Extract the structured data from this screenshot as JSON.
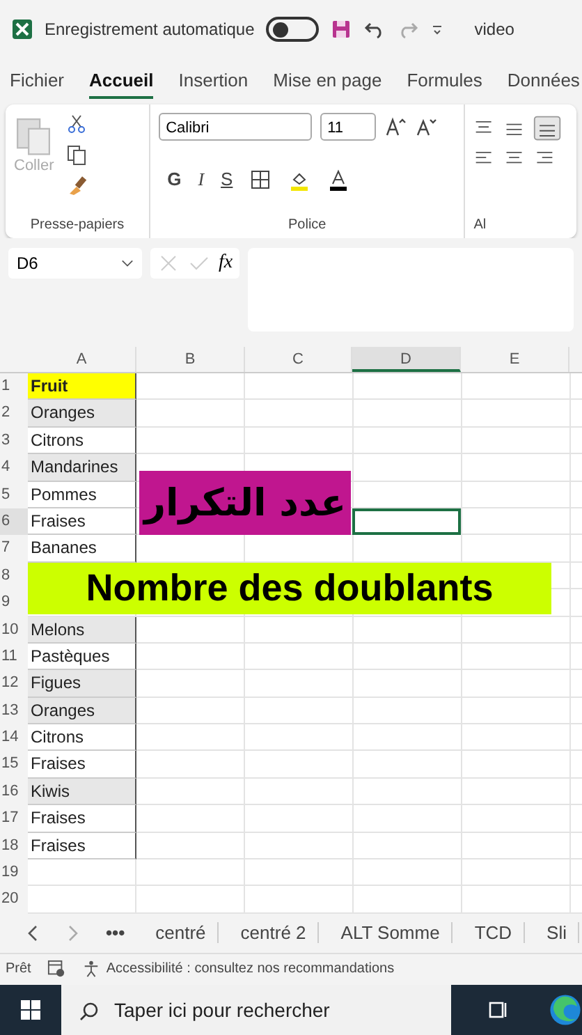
{
  "title_bar": {
    "autosave_label": "Enregistrement automatique",
    "autosave_on": false,
    "file_name": "video"
  },
  "tabs": [
    {
      "label": "Fichier",
      "selected": false
    },
    {
      "label": "Accueil",
      "selected": true
    },
    {
      "label": "Insertion",
      "selected": false
    },
    {
      "label": "Mise en page",
      "selected": false
    },
    {
      "label": "Formules",
      "selected": false
    },
    {
      "label": "Données",
      "selected": false
    }
  ],
  "ribbon": {
    "paste_label": "Coller",
    "clipboard_group": "Presse-papiers",
    "font_name": "Calibri",
    "font_size": "11",
    "bold": "G",
    "italic": "I",
    "underline": "S",
    "font_group": "Police",
    "align_group": "Al"
  },
  "formula_bar": {
    "cell_ref": "D6",
    "fx": "fx"
  },
  "columns": [
    {
      "label": "A",
      "selected": false
    },
    {
      "label": "B",
      "selected": false
    },
    {
      "label": "C",
      "selected": false
    },
    {
      "label": "D",
      "selected": true
    },
    {
      "label": "E",
      "selected": false
    }
  ],
  "rows": [
    {
      "number": "1",
      "a": "Fruit",
      "kind": "header"
    },
    {
      "number": "2",
      "a": "Oranges",
      "kind": "shaded"
    },
    {
      "number": "3",
      "a": "Citrons",
      "kind": "plain"
    },
    {
      "number": "4",
      "a": "Mandarines",
      "kind": "shaded"
    },
    {
      "number": "5",
      "a": "Pommes",
      "kind": "plain"
    },
    {
      "number": "6",
      "a": "Fraises",
      "kind": "plain",
      "selected": true
    },
    {
      "number": "7",
      "a": "Bananes",
      "kind": "plain"
    },
    {
      "number": "8"
    },
    {
      "number": "9"
    },
    {
      "number": "10",
      "a": "Melons",
      "kind": "shaded"
    },
    {
      "number": "11",
      "a": "Pastèques",
      "kind": "plain"
    },
    {
      "number": "12",
      "a": "Figues",
      "kind": "shaded"
    },
    {
      "number": "13",
      "a": "Oranges",
      "kind": "shaded"
    },
    {
      "number": "14",
      "a": "Citrons",
      "kind": "plain"
    },
    {
      "number": "15",
      "a": "Fraises",
      "kind": "plain"
    },
    {
      "number": "16",
      "a": "Kiwis",
      "kind": "shaded"
    },
    {
      "number": "17",
      "a": "Fraises",
      "kind": "plain"
    },
    {
      "number": "18",
      "a": "Fraises",
      "kind": "plain"
    },
    {
      "number": "19"
    },
    {
      "number": "20"
    }
  ],
  "captions": [
    {
      "text": "عدد التكرار",
      "kind": "arabic"
    },
    {
      "text": "Nombre des doublants",
      "kind": "banner"
    }
  ],
  "sheet_tabs": {
    "more": "•••",
    "tabs": [
      "centré",
      "centré 2",
      "ALT Somme",
      "TCD",
      "Sli"
    ]
  },
  "status_bar": {
    "ready": "Prêt",
    "accessibility": "Accessibilité : consultez nos recommandations"
  },
  "taskbar": {
    "search_placeholder": "Taper ici pour rechercher"
  }
}
